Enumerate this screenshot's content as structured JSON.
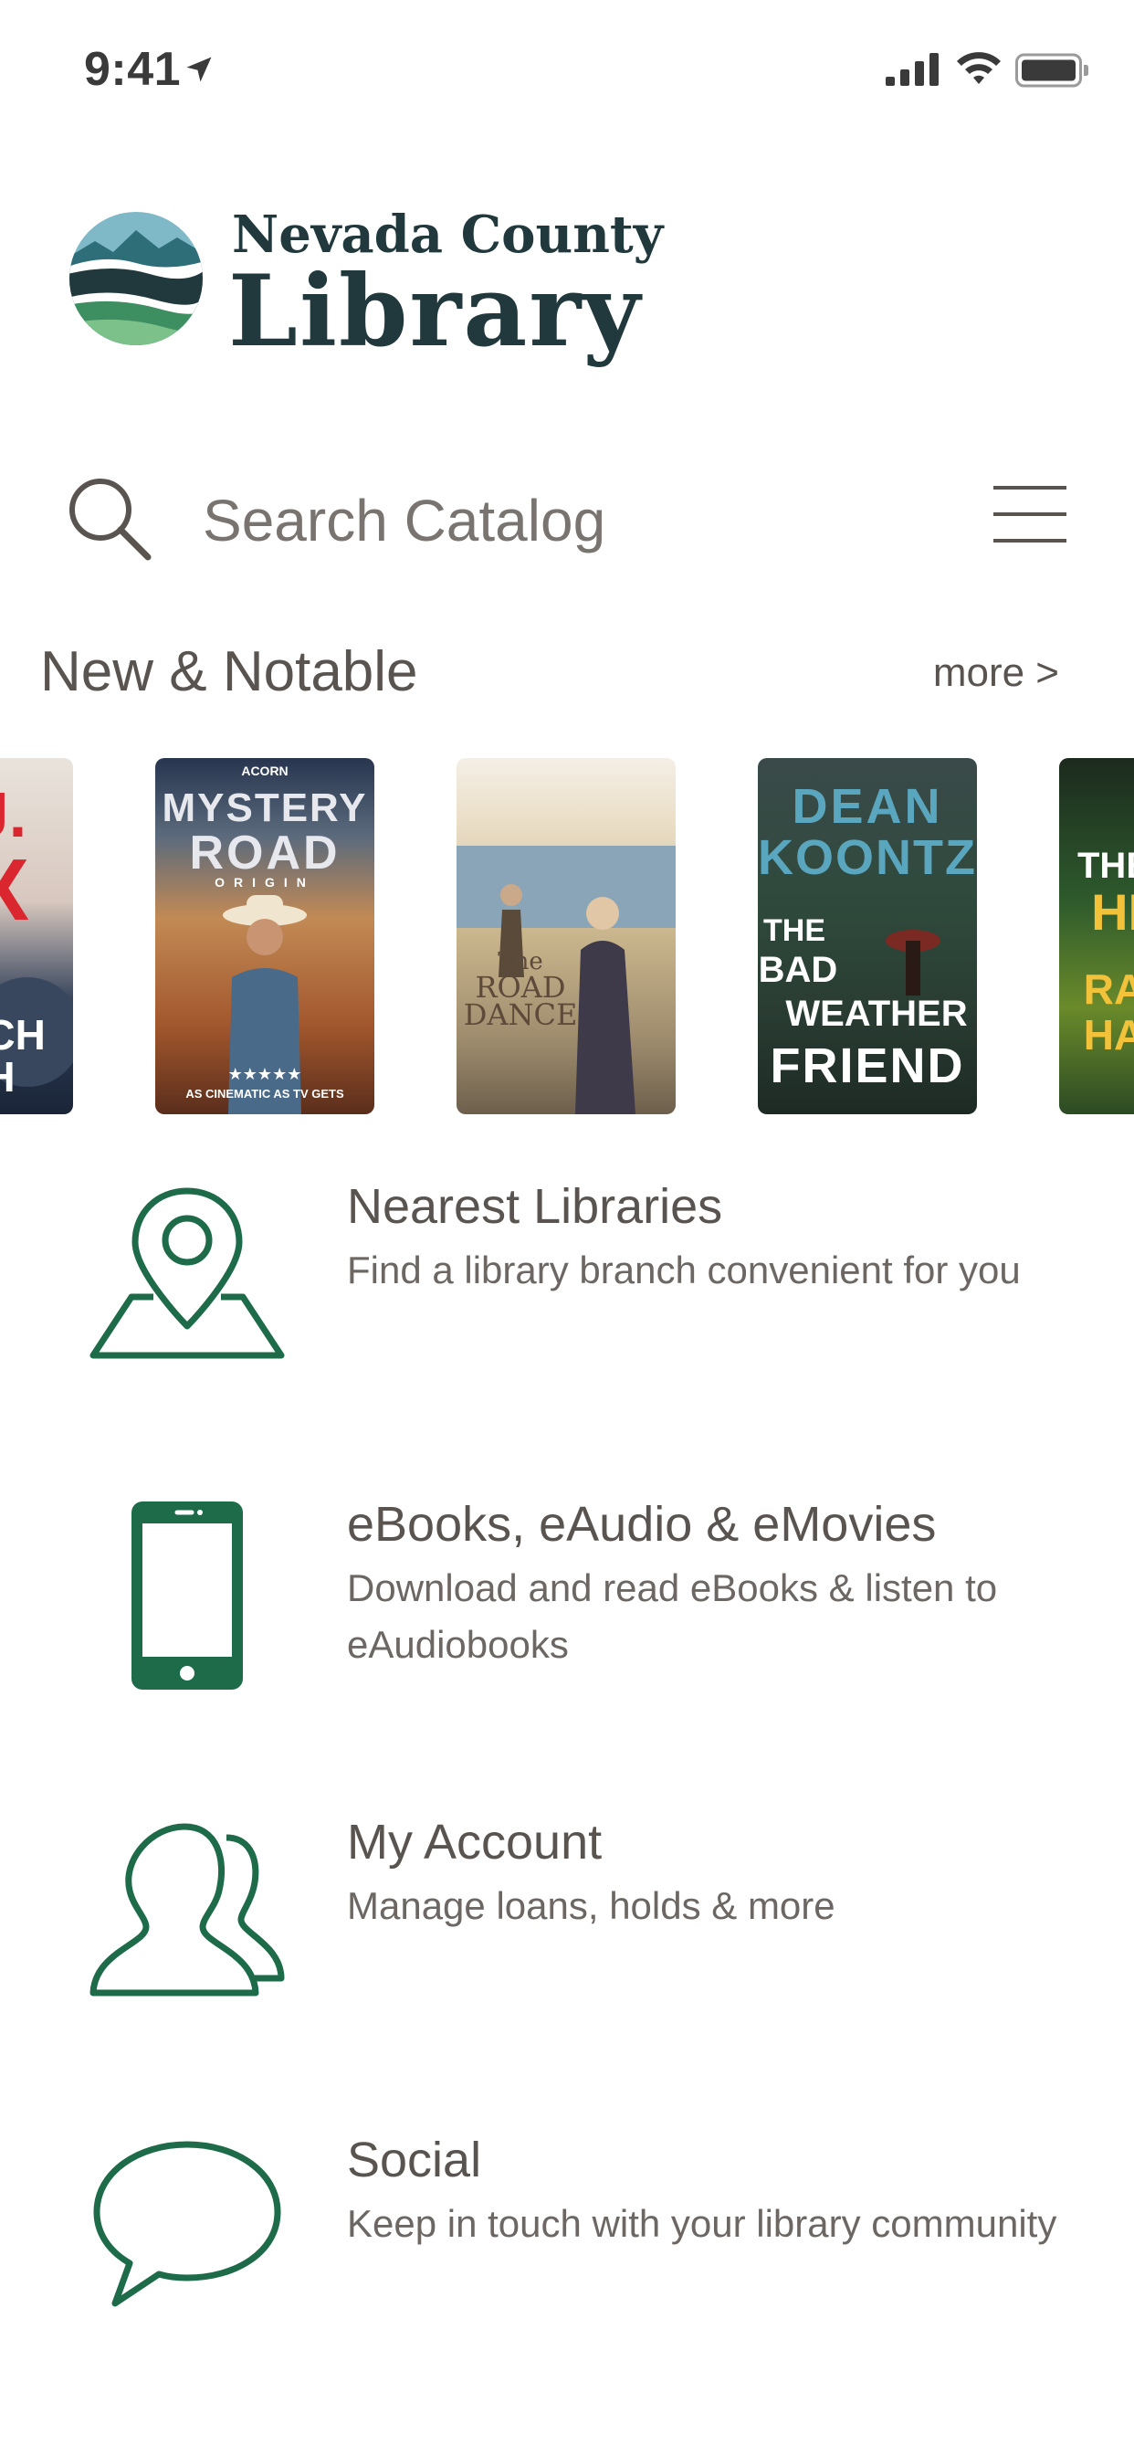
{
  "status": {
    "time": "9:41",
    "location_icon": "location-arrow-icon",
    "signal_icon": "cellular-signal-icon",
    "wifi_icon": "wifi-icon",
    "battery_icon": "battery-icon"
  },
  "brand": {
    "line1": "Nevada County",
    "line2": "Library",
    "logo_icon": "mountain-landscape-logo",
    "color": "#21393c",
    "accent_green": "#1e6b49"
  },
  "search": {
    "placeholder": "Search Catalog",
    "value": "",
    "search_icon": "search-icon",
    "menu_icon": "hamburger-menu-icon"
  },
  "new_notable": {
    "title": "New & Notable",
    "more_label": "more >",
    "books": [
      {
        "cover_lines": [
          "J.",
          "X",
          "NCH",
          "H"
        ]
      },
      {
        "cover_lines": [
          "ACORN",
          "MYSTERY",
          "ROAD",
          "ORIGIN",
          "★★★★★",
          "AS CINEMATIC AS TV GETS"
        ]
      },
      {
        "cover_lines": [
          "The",
          "ROAD",
          "DANCE"
        ]
      },
      {
        "cover_lines": [
          "DEAN",
          "KOONTZ",
          "THE",
          "BAD",
          "WEATHER",
          "FRIEND"
        ]
      },
      {
        "cover_lines": [
          "THE",
          "HE",
          "RA",
          "HA"
        ]
      }
    ]
  },
  "features": [
    {
      "title": "Nearest Libraries",
      "description": "Find a library branch convenient for you",
      "icon": "map-pin-icon"
    },
    {
      "title": "eBooks, eAudio & eMovies",
      "description": "Download and read eBooks & listen to eAudiobooks",
      "icon": "smartphone-icon"
    },
    {
      "title": "My Account",
      "description": "Manage loans, holds & more",
      "icon": "users-icon"
    },
    {
      "title": "Social",
      "description": "Keep in touch with your library community",
      "icon": "speech-bubble-icon"
    }
  ]
}
